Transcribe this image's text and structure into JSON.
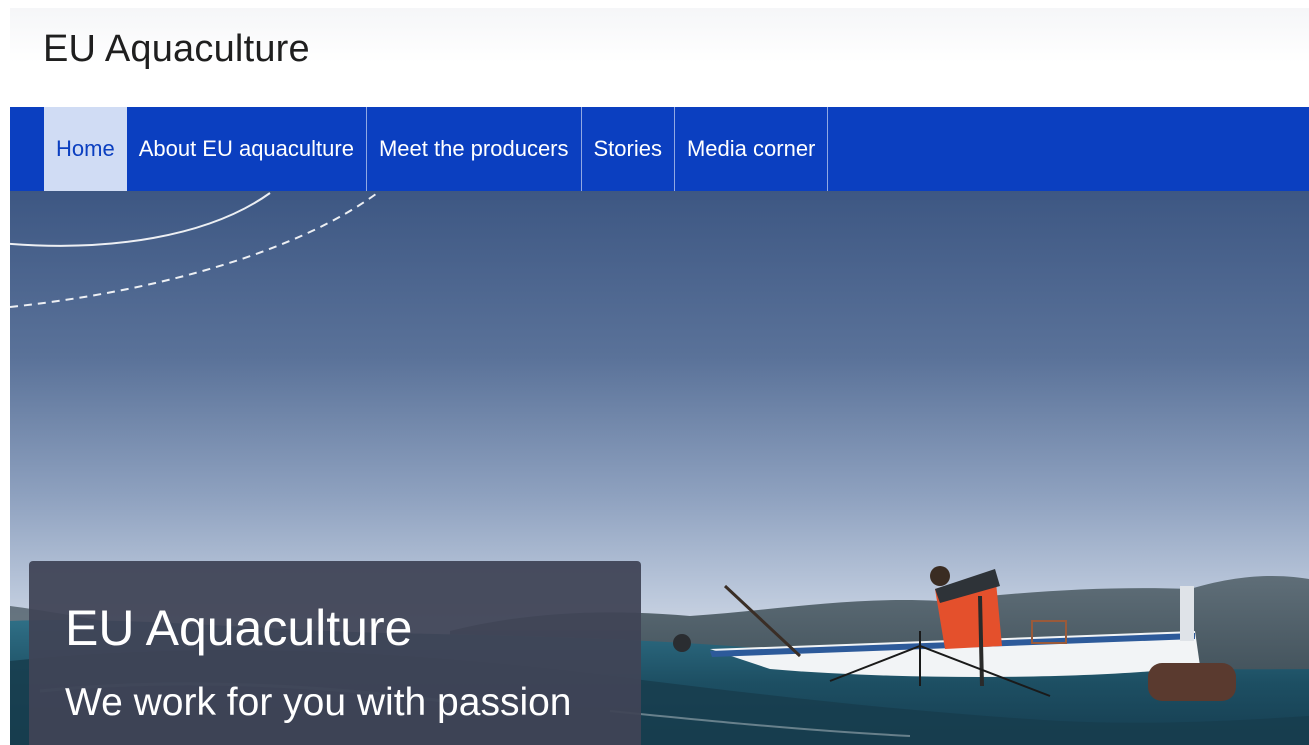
{
  "header": {
    "site_title": "EU Aquaculture"
  },
  "nav": {
    "items": [
      {
        "label": "Home",
        "active": true
      },
      {
        "label": "About EU aquaculture",
        "active": false
      },
      {
        "label": "Meet the producers",
        "active": false
      },
      {
        "label": "Stories",
        "active": false
      },
      {
        "label": "Media corner",
        "active": false
      }
    ]
  },
  "hero": {
    "title": "EU Aquaculture",
    "subtitle": "We work for you with passion"
  },
  "colors": {
    "nav_background": "#0b3fc0",
    "nav_active_background": "#d0dcf4",
    "caption_background": "#404456"
  }
}
